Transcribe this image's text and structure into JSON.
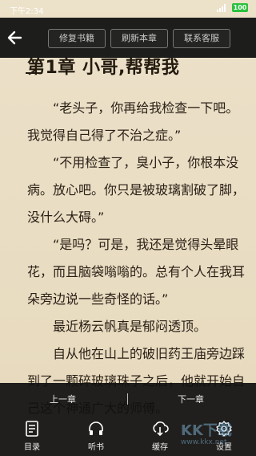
{
  "status": {
    "time": "下午2:34",
    "battery": "100"
  },
  "toolbar": {
    "buttons": [
      "修复书籍",
      "刷新本章",
      "联系客服"
    ]
  },
  "chapter": {
    "title": "第1章 小哥,帮帮我",
    "paragraphs": [
      "“老头子，你再给我检查一下吧。我觉得自己得了不治之症。”",
      "“不用检查了，臭小子，你根本没病。放心吧。你只是被玻璃割破了脚，没什么大碍。”",
      "“是吗？可是，我还是觉得头晕眼花，而且脑袋嗡嗡的。总有个人在我耳朵旁边说一些奇怪的话。”",
      "最近杨云帆真是郁闷透顶。",
      "自从他在山上的破旧药王庙旁边踩到了一颗碎玻璃珠子之后，他就开始自己这个神通广大的师傅。"
    ]
  },
  "nav": {
    "prev": "上一章",
    "next": "下一章"
  },
  "tools": [
    {
      "label": "目录",
      "icon": "catalog-icon"
    },
    {
      "label": "听书",
      "icon": "headphones-icon"
    },
    {
      "label": "缓存",
      "icon": "download-icon"
    },
    {
      "label": "设置",
      "icon": "gear-icon"
    }
  ],
  "watermark": {
    "text": "KK下载",
    "url": "www.kkx.net"
  }
}
